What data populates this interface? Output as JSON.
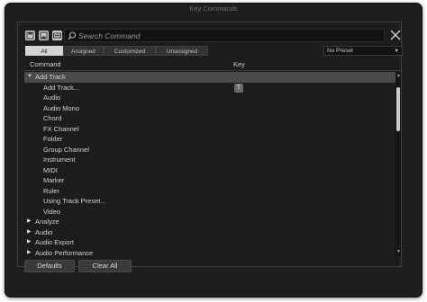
{
  "window": {
    "title": "Key Commands"
  },
  "toolbar": {
    "search_placeholder": "Search Command",
    "icons": [
      "import-icon",
      "export-icon",
      "macros-icon"
    ]
  },
  "filters": {
    "tabs": [
      {
        "label": "All",
        "active": true
      },
      {
        "label": "Assigned",
        "active": false
      },
      {
        "label": "Customized",
        "active": false
      },
      {
        "label": "Unassigned",
        "active": false
      }
    ],
    "preset_value": "No Preset"
  },
  "table": {
    "columns": {
      "command": "Command",
      "key": "Key"
    },
    "rows": [
      {
        "label": "Add Track",
        "type": "category",
        "expanded": true,
        "selected": true,
        "key": ""
      },
      {
        "label": "Add Track...",
        "type": "item",
        "key": "T"
      },
      {
        "label": "Audio",
        "type": "item",
        "key": ""
      },
      {
        "label": "Audio Mono",
        "type": "item",
        "key": ""
      },
      {
        "label": "Chord",
        "type": "item",
        "key": ""
      },
      {
        "label": "FX Channel",
        "type": "item",
        "key": ""
      },
      {
        "label": "Folder",
        "type": "item",
        "key": ""
      },
      {
        "label": "Group Channel",
        "type": "item",
        "key": ""
      },
      {
        "label": "Instrument",
        "type": "item",
        "key": ""
      },
      {
        "label": "MIDI",
        "type": "item",
        "key": ""
      },
      {
        "label": "Marker",
        "type": "item",
        "key": ""
      },
      {
        "label": "Ruler",
        "type": "item",
        "key": ""
      },
      {
        "label": "Using Track Preset...",
        "type": "item",
        "key": ""
      },
      {
        "label": "Video",
        "type": "item",
        "key": ""
      },
      {
        "label": "Analyze",
        "type": "category",
        "expanded": false,
        "key": ""
      },
      {
        "label": "Audio",
        "type": "category",
        "expanded": false,
        "key": ""
      },
      {
        "label": "Audio Export",
        "type": "category",
        "expanded": false,
        "key": ""
      },
      {
        "label": "Audio Performance",
        "type": "category",
        "expanded": false,
        "key": ""
      }
    ]
  },
  "buttons": {
    "defaults_label": "Defaults",
    "clear_all_label": "Clear All"
  }
}
